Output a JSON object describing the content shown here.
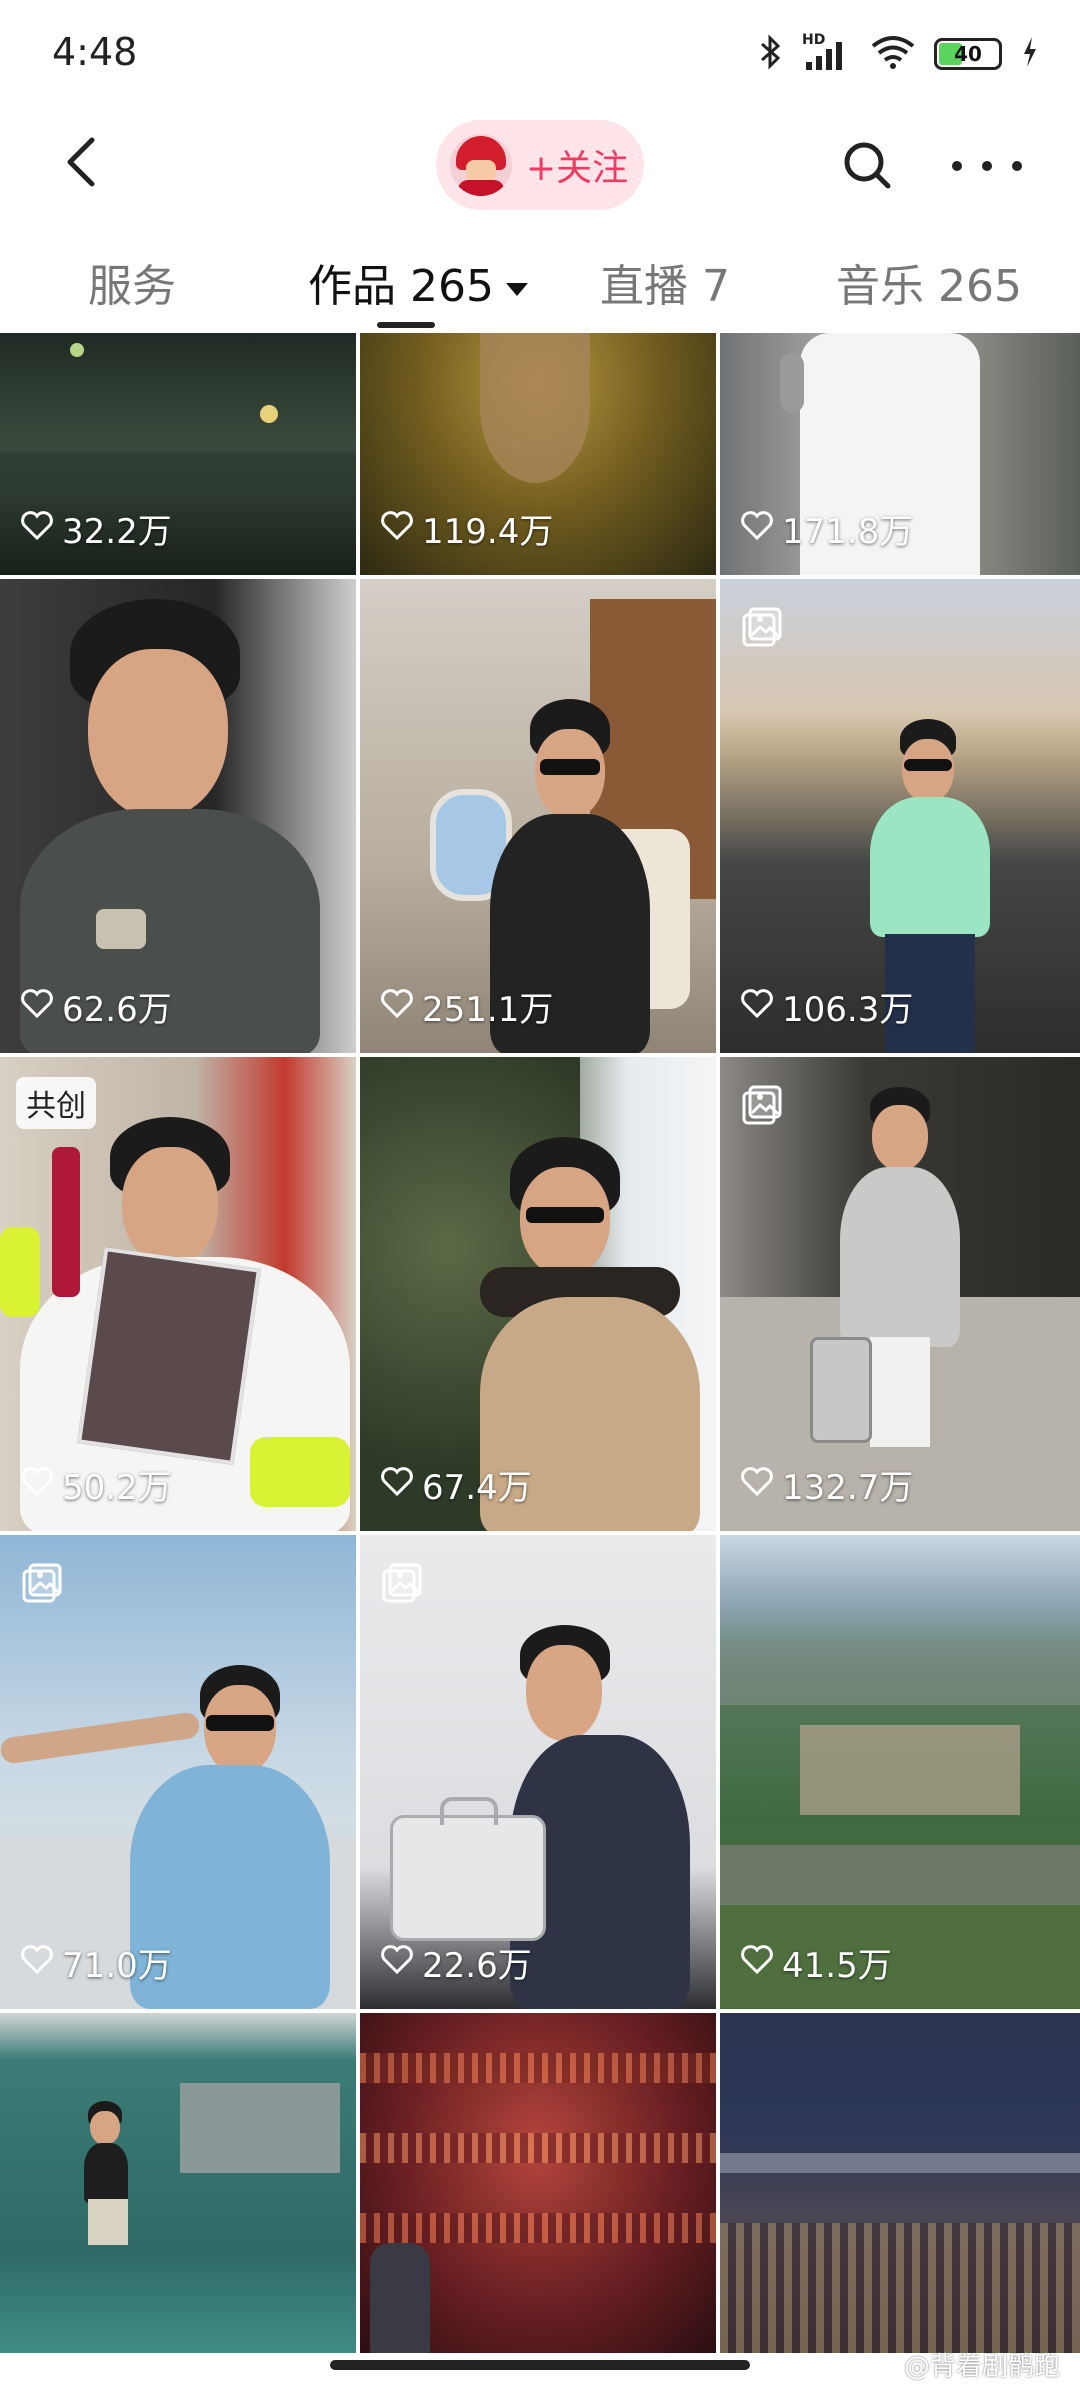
{
  "status_bar": {
    "time": "4:48",
    "network_label": "HD",
    "battery_level": "40",
    "battery_percent": 40
  },
  "header": {
    "follow_label": "+关注",
    "back_icon": "chevron-left-icon",
    "search_icon": "search-icon",
    "more_icon": "more-horizontal-icon"
  },
  "tabs": [
    {
      "label": "服务",
      "active": false
    },
    {
      "label": "作品 265",
      "active": true
    },
    {
      "label": "直播 7",
      "active": false
    },
    {
      "label": "音乐 265",
      "active": false
    }
  ],
  "videos": [
    {
      "likes": "32.2万"
    },
    {
      "likes": "119.4万"
    },
    {
      "likes": "171.8万"
    },
    {
      "likes": "62.6万"
    },
    {
      "likes": "251.1万"
    },
    {
      "likes": "106.3万",
      "gallery": true
    },
    {
      "likes": "50.2万",
      "badge": "共创"
    },
    {
      "likes": "67.4万"
    },
    {
      "likes": "132.7万",
      "gallery": true
    },
    {
      "likes": "71.0万",
      "gallery": true
    },
    {
      "likes": "22.6万",
      "gallery": true
    },
    {
      "likes": "41.5万"
    },
    {
      "likes": ""
    },
    {
      "likes": ""
    },
    {
      "likes": ""
    }
  ],
  "watermark": "@背着剧鹘跑",
  "colors": {
    "accent": "#f03a5f",
    "pill_bg": "#ffe4ea",
    "battery_fill": "#5bd45b"
  }
}
